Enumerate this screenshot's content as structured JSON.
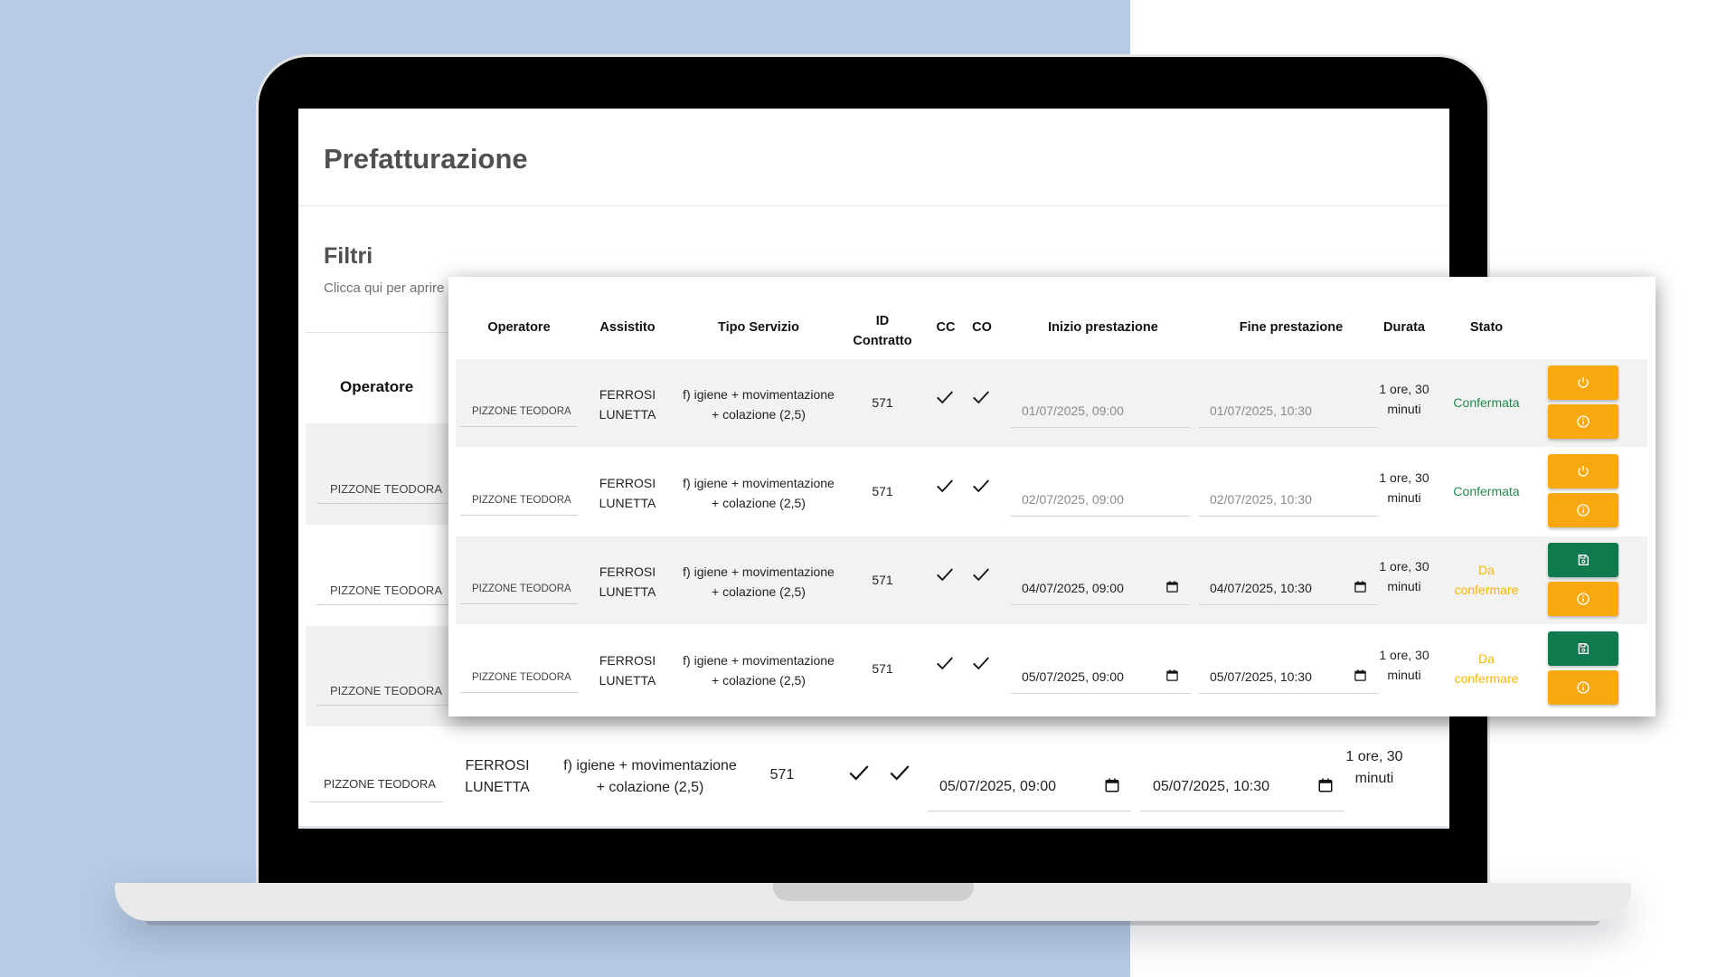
{
  "colors": {
    "background_left": "#b6cae4",
    "confirmed": "#1f8a4c",
    "pending": "#f5b800",
    "btn_orange": "#f9a90f",
    "btn_green": "#0e7a4d"
  },
  "page": {
    "title": "Prefatturazione",
    "filters_title": "Filtri",
    "filters_hint": "Clicca qui per aprire"
  },
  "background_table": {
    "operator_header": "Operatore",
    "rows": [
      {
        "operatore": "PIZZONE TEODORA"
      },
      {
        "operatore": "PIZZONE TEODORA"
      },
      {
        "operatore": "PIZZONE TEODORA"
      }
    ],
    "bottom_row": {
      "operatore": "PIZZONE TEODORA",
      "assistito_l1": "FERROSI",
      "assistito_l2": "LUNETTA",
      "servizio_l1": "f) igiene + movimentazione",
      "servizio_l2": "+ colazione (2,5)",
      "id_contratto": "571",
      "inizio": "05/07/2025, 09:00",
      "fine": "05/07/2025, 10:30",
      "durata_l1": "1 ore, 30",
      "durata_l2": "minuti"
    }
  },
  "table": {
    "headers": {
      "operatore": "Operatore",
      "assistito": "Assistito",
      "tipo_servizio": "Tipo Servizio",
      "id_contratto_l1": "ID",
      "id_contratto_l2": "Contratto",
      "cc": "CC",
      "co": "CO",
      "inizio": "Inizio prestazione",
      "fine": "Fine prestazione",
      "durata": "Durata",
      "stato": "Stato"
    },
    "rows": [
      {
        "operatore": "PIZZONE TEODORA",
        "assistito_l1": "FERROSI",
        "assistito_l2": "LUNETTA",
        "servizio_l1": "f) igiene + movimentazione",
        "servizio_l2": "+ colazione (2,5)",
        "id_contratto": "571",
        "inizio": "01/07/2025, 09:00",
        "fine": "01/07/2025, 10:30",
        "durata_l1": "1 ore, 30",
        "durata_l2": "minuti",
        "stato_l1": "Confermata",
        "stato_l2": ""
      },
      {
        "operatore": "PIZZONE TEODORA",
        "assistito_l1": "FERROSI",
        "assistito_l2": "LUNETTA",
        "servizio_l1": "f) igiene + movimentazione",
        "servizio_l2": "+ colazione (2,5)",
        "id_contratto": "571",
        "inizio": "02/07/2025, 09:00",
        "fine": "02/07/2025, 10:30",
        "durata_l1": "1 ore, 30",
        "durata_l2": "minuti",
        "stato_l1": "Confermata",
        "stato_l2": ""
      },
      {
        "operatore": "PIZZONE TEODORA",
        "assistito_l1": "FERROSI",
        "assistito_l2": "LUNETTA",
        "servizio_l1": "f) igiene + movimentazione",
        "servizio_l2": "+ colazione (2,5)",
        "id_contratto": "571",
        "inizio": "04/07/2025, 09:00",
        "fine": "04/07/2025, 10:30",
        "durata_l1": "1 ore, 30",
        "durata_l2": "minuti",
        "stato_l1": "Da",
        "stato_l2": "confermare"
      },
      {
        "operatore": "PIZZONE TEODORA",
        "assistito_l1": "FERROSI",
        "assistito_l2": "LUNETTA",
        "servizio_l1": "f) igiene + movimentazione",
        "servizio_l2": "+ colazione (2,5)",
        "id_contratto": "571",
        "inizio": "05/07/2025, 09:00",
        "fine": "05/07/2025, 10:30",
        "durata_l1": "1 ore, 30",
        "durata_l2": "minuti",
        "stato_l1": "Da",
        "stato_l2": "confermare"
      }
    ]
  }
}
